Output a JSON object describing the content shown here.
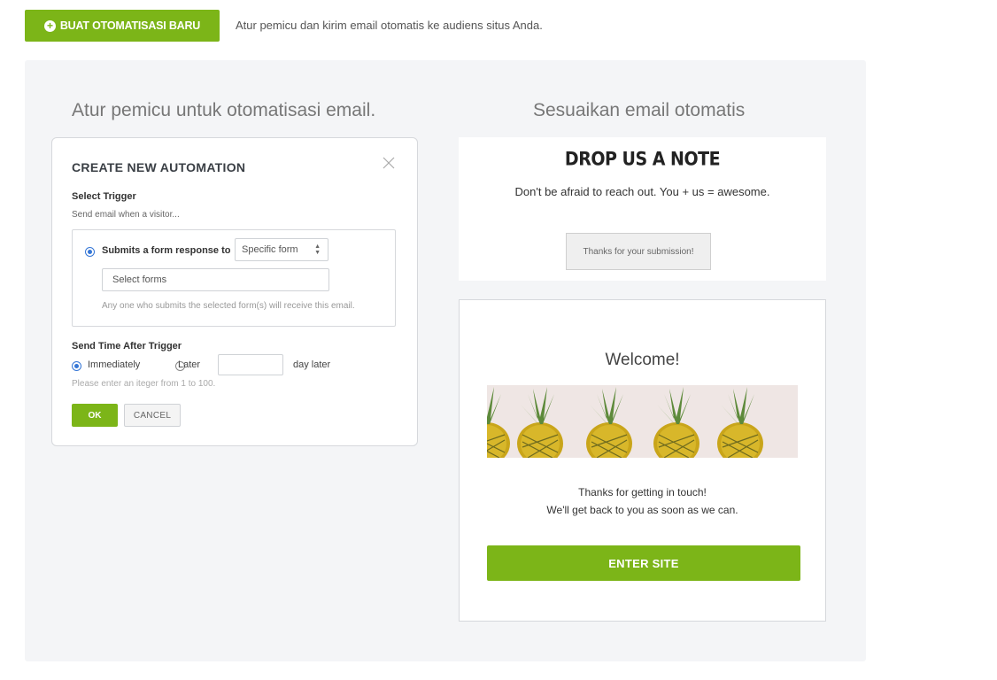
{
  "header": {
    "new_button_label": "BUAT OTOMATISASI BARU",
    "description": "Atur pemicu dan kirim email otomatis ke audiens situs Anda."
  },
  "left_column": {
    "title": "Atur pemicu untuk otomatisasi email."
  },
  "right_column": {
    "title": "Sesuaikan email otomatis"
  },
  "automation_dialog": {
    "title": "CREATE NEW AUTOMATION",
    "select_trigger_label": "Select Trigger",
    "select_trigger_help": "Send email when a visitor...",
    "trigger_option_label": "Submits a form response to",
    "form_select_value": "Specific form",
    "forms_input_placeholder": "Select forms",
    "forms_help": "Any one who submits the selected form(s) will receive this email.",
    "send_time_label": "Send Time After Trigger",
    "immediately_label": "Immediately",
    "later_label": "Later",
    "day_suffix": "day later",
    "integer_help": "Please enter an iteger  from 1 to 100.",
    "ok_label": "OK",
    "cancel_label": "CANCEL"
  },
  "note_preview": {
    "title": "DROP US A NOTE",
    "subtitle": "Don't be afraid to reach out. You + us = awesome.",
    "thanks_button": "Thanks for your submission!"
  },
  "welcome_preview": {
    "title": "Welcome!",
    "line1": "Thanks for getting in touch!",
    "line2": "We'll get back to you as soon as we can.",
    "enter_button": "ENTER SITE"
  },
  "colors": {
    "accent": "#7cb518",
    "panel_bg": "#f4f5f7",
    "radio_selected": "#3576d6"
  },
  "icons": [
    "plus-circle-icon",
    "close-icon",
    "select-arrows-icon",
    "pineapples-image"
  ]
}
